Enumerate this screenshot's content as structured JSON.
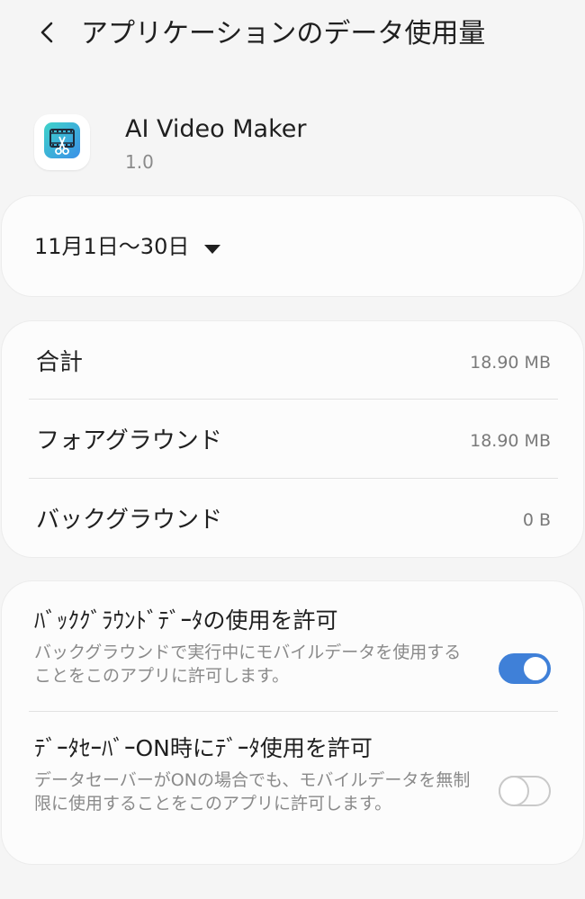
{
  "header": {
    "title": "アプリケーションのデータ使用量",
    "back_icon": "back-chevron-icon"
  },
  "app": {
    "name": "AI Video Maker",
    "version": "1.0",
    "icon": "film-scissors-icon",
    "icon_colors": [
      "#3fd3c9",
      "#3a8fe8"
    ]
  },
  "period": {
    "label": "11月1日〜30日",
    "dropdown_icon": "dropdown-triangle-icon"
  },
  "usage": [
    {
      "label": "合計",
      "value": "18.90 MB"
    },
    {
      "label": "フォアグラウンド",
      "value": "18.90 MB"
    },
    {
      "label": "バックグラウンド",
      "value": "0 B"
    }
  ],
  "settings": [
    {
      "title": "ﾊﾞｯｸｸﾞﾗｳﾝﾄﾞﾃﾞｰﾀの使用を許可",
      "description": "バックグラウンドで実行中にモバイルデータを使用することをこのアプリに許可します。",
      "enabled": true
    },
    {
      "title": "ﾃﾞｰﾀｾｰﾊﾞｰON時にﾃﾞｰﾀ使用を許可",
      "description": "データセーバーがONの場合でも、モバイルデータを無制限に使用することをこのアプリに許可します。",
      "enabled": false
    }
  ],
  "colors": {
    "accent": "#3f80d8",
    "background": "#f5f5f5",
    "card": "#fcfcfc"
  }
}
